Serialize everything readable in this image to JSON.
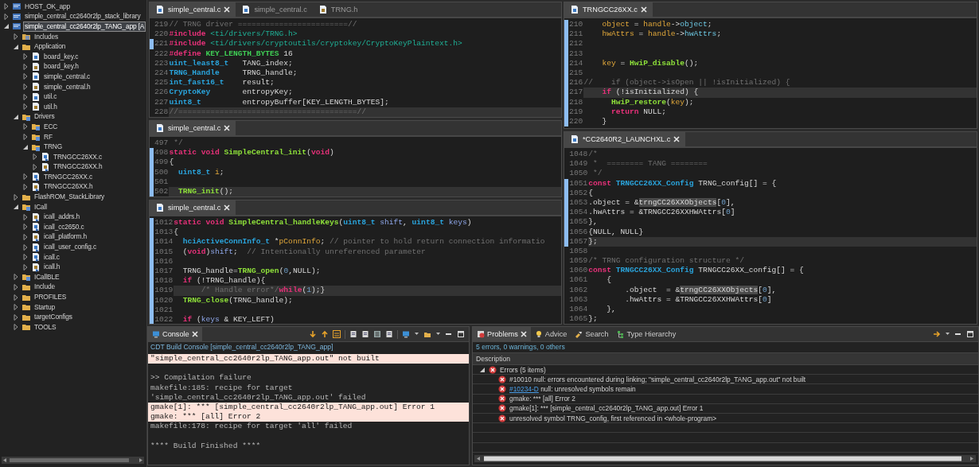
{
  "project_tree": [
    {
      "label": "HOST_OK_app",
      "kind": "project",
      "expanded": false,
      "selected": false
    },
    {
      "label": "simple_central_cc2640r2lp_stack_library",
      "kind": "project",
      "expanded": false,
      "selected": false
    },
    {
      "label": "simple_central_cc2640r2lp_TANG_app [A",
      "kind": "project",
      "expanded": true,
      "selected": true,
      "children": [
        {
          "label": "Includes",
          "kind": "includes",
          "expanded": false,
          "selected": false
        },
        {
          "label": "Application",
          "kind": "folder",
          "expanded": true,
          "selected": false,
          "children": [
            {
              "label": "board_key.c",
              "kind": "c",
              "expanded": false,
              "selected": false
            },
            {
              "label": "board_key.h",
              "kind": "h",
              "expanded": false,
              "selected": false
            },
            {
              "label": "simple_central.c",
              "kind": "c",
              "expanded": false,
              "selected": false
            },
            {
              "label": "simple_central.h",
              "kind": "h",
              "expanded": false,
              "selected": false
            },
            {
              "label": "util.c",
              "kind": "c",
              "expanded": false,
              "selected": false
            },
            {
              "label": "util.h",
              "kind": "h",
              "expanded": false,
              "selected": false
            }
          ]
        },
        {
          "label": "Drivers",
          "kind": "linked-folder",
          "expanded": true,
          "selected": false,
          "children": [
            {
              "label": "ECC",
              "kind": "linked-folder",
              "expanded": false,
              "selected": false
            },
            {
              "label": "RF",
              "kind": "linked-folder",
              "expanded": false,
              "selected": false
            },
            {
              "label": "TRNG",
              "kind": "linked-folder",
              "expanded": true,
              "selected": false,
              "children": [
                {
                  "label": "TRNGCC26XX.c",
                  "kind": "linked-c",
                  "expanded": false,
                  "selected": false
                },
                {
                  "label": "TRNGCC26XX.h",
                  "kind": "linked-h",
                  "expanded": false,
                  "selected": false
                }
              ]
            },
            {
              "label": "TRNGCC26XX.c",
              "kind": "linked-c",
              "expanded": false,
              "selected": false
            },
            {
              "label": "TRNGCC26XX.h",
              "kind": "linked-h",
              "expanded": false,
              "selected": false
            }
          ]
        },
        {
          "label": "FlashROM_StackLibrary",
          "kind": "folder",
          "expanded": false,
          "selected": false
        },
        {
          "label": "ICall",
          "kind": "linked-folder",
          "expanded": true,
          "selected": false,
          "children": [
            {
              "label": "icall_addrs.h",
              "kind": "linked-h",
              "expanded": false,
              "selected": false
            },
            {
              "label": "icall_cc2650.c",
              "kind": "linked-c",
              "expanded": false,
              "selected": false
            },
            {
              "label": "icall_platform.h",
              "kind": "linked-h",
              "expanded": false,
              "selected": false
            },
            {
              "label": "icall_user_config.c",
              "kind": "linked-c",
              "expanded": false,
              "selected": false
            },
            {
              "label": "icall.c",
              "kind": "linked-c",
              "expanded": false,
              "selected": false
            },
            {
              "label": "icall.h",
              "kind": "linked-h",
              "expanded": false,
              "selected": false
            }
          ]
        },
        {
          "label": "ICallBLE",
          "kind": "linked-folder",
          "expanded": false,
          "selected": false
        },
        {
          "label": "Include",
          "kind": "folder",
          "expanded": false,
          "selected": false
        },
        {
          "label": "PROFILES",
          "kind": "folder",
          "expanded": false,
          "selected": false
        },
        {
          "label": "Startup",
          "kind": "folder",
          "expanded": false,
          "selected": false
        },
        {
          "label": "targetConfigs",
          "kind": "folder",
          "expanded": false,
          "selected": false
        },
        {
          "label": "TOOLS",
          "kind": "folder",
          "expanded": false,
          "selected": false
        }
      ]
    }
  ],
  "editor_columns": [
    {
      "editors": [
        {
          "tabs": [
            {
              "label": "simple_central.c",
              "kind": "c",
              "selected": true
            },
            {
              "label": "simple_central.c",
              "kind": "c",
              "selected": false
            },
            {
              "label": "TRNG.h",
              "kind": "h",
              "selected": false
            }
          ],
          "lines": [
            {
              "number": "219",
              "changed": false,
              "current": false,
              "tokens": [
                {
                  "kind": "comment",
                  "text": "// TRNG driver ========================//"
                }
              ]
            },
            {
              "number": "220",
              "changed": false,
              "current": false,
              "tokens": [
                {
                  "kind": "keyword",
                  "text": "#include "
                },
                {
                  "kind": "string",
                  "text": "<ti/drivers/TRNG.h>"
                }
              ]
            },
            {
              "number": "221",
              "changed": true,
              "current": false,
              "tokens": [
                {
                  "kind": "keyword",
                  "text": "#include "
                },
                {
                  "kind": "string",
                  "text": "<ti/drivers/cryptoutils/cryptokey/CryptoKeyPlaintext.h>"
                }
              ]
            },
            {
              "number": "222",
              "changed": false,
              "current": false,
              "tokens": [
                {
                  "kind": "keyword",
                  "text": "#define "
                },
                {
                  "kind": "macro",
                  "text": "KEY_LENGTH_BYTES"
                },
                {
                  "kind": "plain",
                  "text": " 16"
                }
              ]
            },
            {
              "number": "223",
              "changed": false,
              "current": false,
              "tokens": [
                {
                  "kind": "type",
                  "text": "uint_least8_t"
                },
                {
                  "kind": "plain",
                  "text": "   TANG_index;"
                }
              ]
            },
            {
              "number": "224",
              "changed": false,
              "current": false,
              "tokens": [
                {
                  "kind": "type",
                  "text": "TRNG_Handle"
                },
                {
                  "kind": "plain",
                  "text": "     TRNG_handle;"
                }
              ]
            },
            {
              "number": "225",
              "changed": false,
              "current": false,
              "tokens": [
                {
                  "kind": "type",
                  "text": "int_fast16_t"
                },
                {
                  "kind": "plain",
                  "text": "    result;"
                }
              ]
            },
            {
              "number": "226",
              "changed": false,
              "current": false,
              "tokens": [
                {
                  "kind": "type",
                  "text": "CryptoKey"
                },
                {
                  "kind": "plain",
                  "text": "       entropyKey;"
                }
              ]
            },
            {
              "number": "227",
              "changed": false,
              "current": false,
              "tokens": [
                {
                  "kind": "type",
                  "text": "uint8_t"
                },
                {
                  "kind": "plain",
                  "text": "         entropyBuffer[KEY_LENGTH_BYTES];"
                }
              ]
            },
            {
              "number": "228",
              "changed": false,
              "current": true,
              "tokens": [
                {
                  "kind": "comment",
                  "text": "//=======================================//"
                }
              ]
            }
          ]
        },
        {
          "tabs": [
            {
              "label": "simple_central.c",
              "kind": "c",
              "selected": true
            }
          ],
          "lines": [
            {
              "number": "497",
              "changed": false,
              "current": false,
              "tokens": [
                {
                  "kind": "comment",
                  "text": " */"
                }
              ]
            },
            {
              "number": "498",
              "changed": true,
              "current": false,
              "tokens": [
                {
                  "kind": "keyword",
                  "text": "static void "
                },
                {
                  "kind": "function",
                  "text": "SimpleCentral_init"
                },
                {
                  "kind": "plain",
                  "text": "("
                },
                {
                  "kind": "keyword",
                  "text": "void"
                },
                {
                  "kind": "plain",
                  "text": ")"
                }
              ]
            },
            {
              "number": "499",
              "changed": true,
              "current": false,
              "tokens": [
                {
                  "kind": "plain",
                  "text": "{"
                }
              ]
            },
            {
              "number": "500",
              "changed": true,
              "current": false,
              "tokens": [
                {
                  "kind": "type",
                  "text": "  uint8_t "
                },
                {
                  "kind": "variable",
                  "text": "i"
                },
                {
                  "kind": "plain",
                  "text": ";"
                }
              ]
            },
            {
              "number": "501",
              "changed": true,
              "current": false
            },
            {
              "number": "502",
              "changed": true,
              "current": true,
              "tokens": [
                {
                  "kind": "function",
                  "text": "  TRNG_init"
                },
                {
                  "kind": "plain",
                  "text": "();"
                }
              ]
            }
          ]
        },
        {
          "tabs": [
            {
              "label": "simple_central.c",
              "kind": "c",
              "selected": true
            }
          ],
          "lines": [
            {
              "number": "1012",
              "changed": true,
              "current": false,
              "tokens": [
                {
                  "kind": "keyword",
                  "text": "static void "
                },
                {
                  "kind": "function",
                  "text": "SimpleCentral_handleKeys"
                },
                {
                  "kind": "plain",
                  "text": "("
                },
                {
                  "kind": "type",
                  "text": "uint8_t "
                },
                {
                  "kind": "parameter",
                  "text": "shift"
                },
                {
                  "kind": "plain",
                  "text": ", "
                },
                {
                  "kind": "type",
                  "text": "uint8_t "
                },
                {
                  "kind": "parameter",
                  "text": "keys"
                },
                {
                  "kind": "plain",
                  "text": ")"
                }
              ]
            },
            {
              "number": "1013",
              "changed": true,
              "current": false,
              "tokens": [
                {
                  "kind": "plain",
                  "text": "{"
                }
              ]
            },
            {
              "number": "1014",
              "changed": true,
              "current": false,
              "tokens": [
                {
                  "kind": "type",
                  "text": "  hciActiveConnInfo_t"
                },
                {
                  "kind": "plain",
                  "text": " *"
                },
                {
                  "kind": "variable",
                  "text": "pConnInfo"
                },
                {
                  "kind": "plain",
                  "text": "; "
                },
                {
                  "kind": "comment",
                  "text": "// pointer to hold return connection informatio"
                }
              ]
            },
            {
              "number": "1015",
              "changed": true,
              "current": false,
              "tokens": [
                {
                  "kind": "plain",
                  "text": "  ("
                },
                {
                  "kind": "keyword",
                  "text": "void"
                },
                {
                  "kind": "plain",
                  "text": ")"
                },
                {
                  "kind": "parameter",
                  "text": "shift"
                },
                {
                  "kind": "plain",
                  "text": ";  "
                },
                {
                  "kind": "comment",
                  "text": "// Intentionally unreferenced parameter"
                }
              ]
            },
            {
              "number": "1016",
              "changed": true,
              "current": false
            },
            {
              "number": "1017",
              "changed": true,
              "current": false,
              "tokens": [
                {
                  "kind": "plain",
                  "text": "  TRNG_handle="
                },
                {
                  "kind": "function",
                  "text": "TRNG_open"
                },
                {
                  "kind": "plain",
                  "text": "("
                },
                {
                  "kind": "number",
                  "text": "0"
                },
                {
                  "kind": "plain",
                  "text": ",NULL);"
                }
              ]
            },
            {
              "number": "1018",
              "changed": true,
              "current": false,
              "tokens": [
                {
                  "kind": "keyword",
                  "text": "  if"
                },
                {
                  "kind": "plain",
                  "text": " (!TRNG_handle){"
                }
              ]
            },
            {
              "number": "1019",
              "changed": true,
              "current": true,
              "tokens": [
                {
                  "kind": "comment",
                  "text": "      /* Handle error*/"
                },
                {
                  "kind": "keyword",
                  "text": "while"
                },
                {
                  "kind": "plain",
                  "text": "("
                },
                {
                  "kind": "number",
                  "text": "1"
                },
                {
                  "kind": "plain",
                  "text": ");}"
                }
              ]
            },
            {
              "number": "1020",
              "changed": true,
              "current": false,
              "tokens": [
                {
                  "kind": "function",
                  "text": "  TRNG_close"
                },
                {
                  "kind": "plain",
                  "text": "(TRNG_handle);"
                }
              ]
            },
            {
              "number": "1021",
              "changed": true,
              "current": false
            },
            {
              "number": "1022",
              "changed": true,
              "current": false,
              "tokens": [
                {
                  "kind": "keyword",
                  "text": "  if"
                },
                {
                  "kind": "plain",
                  "text": " ("
                },
                {
                  "kind": "parameter",
                  "text": "keys"
                },
                {
                  "kind": "plain",
                  "text": " & KEY_LEFT)"
                }
              ]
            }
          ]
        }
      ]
    },
    {
      "editors": [
        {
          "tabs": [
            {
              "label": "TRNGCC26XX.c",
              "kind": "c",
              "selected": true
            }
          ],
          "lines": [
            {
              "number": "210",
              "changed": true,
              "current": false,
              "tokens": [
                {
                  "kind": "variable",
                  "text": "    object"
                },
                {
                  "kind": "plain",
                  "text": " = "
                },
                {
                  "kind": "variable",
                  "text": "handle"
                },
                {
                  "kind": "plain",
                  "text": "->"
                },
                {
                  "kind": "field",
                  "text": "object"
                },
                {
                  "kind": "plain",
                  "text": ";"
                }
              ]
            },
            {
              "number": "211",
              "changed": true,
              "current": false,
              "tokens": [
                {
                  "kind": "variable",
                  "text": "    hwAttrs"
                },
                {
                  "kind": "plain",
                  "text": " = "
                },
                {
                  "kind": "variable",
                  "text": "handle"
                },
                {
                  "kind": "plain",
                  "text": "->"
                },
                {
                  "kind": "field",
                  "text": "hwAttrs"
                },
                {
                  "kind": "plain",
                  "text": ";"
                }
              ]
            },
            {
              "number": "212",
              "changed": true,
              "current": false
            },
            {
              "number": "213",
              "changed": true,
              "current": false
            },
            {
              "number": "214",
              "changed": true,
              "current": false,
              "tokens": [
                {
                  "kind": "variable",
                  "text": "    key"
                },
                {
                  "kind": "plain",
                  "text": " = "
                },
                {
                  "kind": "function",
                  "text": "HwiP_disable"
                },
                {
                  "kind": "plain",
                  "text": "();"
                }
              ]
            },
            {
              "number": "215",
              "changed": true,
              "current": false
            },
            {
              "number": "216",
              "changed": true,
              "current": false,
              "tokens": [
                {
                  "kind": "comment",
                  "text": "//    if (object->isOpen || !isInitialized) {"
                }
              ]
            },
            {
              "number": "217",
              "changed": true,
              "current": true,
              "tokens": [
                {
                  "kind": "keyword",
                  "text": "    if"
                },
                {
                  "kind": "plain",
                  "text": " (!isInitialized) {"
                }
              ]
            },
            {
              "number": "218",
              "changed": true,
              "current": false,
              "tokens": [
                {
                  "kind": "function",
                  "text": "      HwiP_restore"
                },
                {
                  "kind": "plain",
                  "text": "("
                },
                {
                  "kind": "variable",
                  "text": "key"
                },
                {
                  "kind": "plain",
                  "text": ");"
                }
              ]
            },
            {
              "number": "219",
              "changed": true,
              "current": false,
              "tokens": [
                {
                  "kind": "keyword",
                  "text": "      return"
                },
                {
                  "kind": "plain",
                  "text": " NULL;"
                }
              ]
            },
            {
              "number": "220",
              "changed": true,
              "current": false,
              "tokens": [
                {
                  "kind": "plain",
                  "text": "    }"
                }
              ]
            }
          ]
        },
        {
          "tabs": [
            {
              "label": "*CC2640R2_LAUNCHXL.c",
              "kind": "c",
              "selected": true
            }
          ],
          "lines": [
            {
              "number": "1048",
              "changed": false,
              "current": false,
              "tokens": [
                {
                  "kind": "comment",
                  "text": "/*"
                }
              ]
            },
            {
              "number": "1049",
              "changed": false,
              "current": false,
              "tokens": [
                {
                  "kind": "comment",
                  "text": " *  ======== TANG ========"
                }
              ]
            },
            {
              "number": "1050",
              "changed": false,
              "current": false,
              "tokens": [
                {
                  "kind": "comment",
                  "text": " */"
                }
              ]
            },
            {
              "number": "1051",
              "changed": true,
              "current": false,
              "tokens": [
                {
                  "kind": "keyword",
                  "text": "const "
                },
                {
                  "kind": "type",
                  "text": "TRNGCC26XX_Config"
                },
                {
                  "kind": "plain",
                  "text": " TRNG_config[] = {"
                }
              ]
            },
            {
              "number": "1052",
              "changed": true,
              "current": false,
              "tokens": [
                {
                  "kind": "plain",
                  "text": "{"
                }
              ]
            },
            {
              "number": "1053",
              "changed": true,
              "current": false,
              "tokens": [
                {
                  "kind": "plain",
                  "text": ".object = &"
                },
                {
                  "kind": "occurrence",
                  "text": "trngCC26XXObjects"
                },
                {
                  "kind": "plain",
                  "text": "["
                },
                {
                  "kind": "number",
                  "text": "0"
                },
                {
                  "kind": "plain",
                  "text": "],"
                }
              ]
            },
            {
              "number": "1054",
              "changed": true,
              "current": false,
              "tokens": [
                {
                  "kind": "plain",
                  "text": ".hwAttrs = &TRNGCC26XXHWAttrs["
                },
                {
                  "kind": "number",
                  "text": "0"
                },
                {
                  "kind": "plain",
                  "text": "]"
                }
              ]
            },
            {
              "number": "1055",
              "changed": true,
              "current": false,
              "tokens": [
                {
                  "kind": "plain",
                  "text": "},"
                }
              ]
            },
            {
              "number": "1056",
              "changed": true,
              "current": false,
              "tokens": [
                {
                  "kind": "plain",
                  "text": "{NULL, NULL}"
                }
              ]
            },
            {
              "number": "1057",
              "changed": true,
              "current": true,
              "tokens": [
                {
                  "kind": "plain",
                  "text": "};"
                }
              ]
            },
            {
              "number": "1058",
              "changed": false,
              "current": false
            },
            {
              "number": "1059",
              "changed": false,
              "current": false,
              "tokens": [
                {
                  "kind": "comment",
                  "text": "/* TRNG configuration structure */"
                }
              ]
            },
            {
              "number": "1060",
              "changed": false,
              "current": false,
              "tokens": [
                {
                  "kind": "keyword",
                  "text": "const "
                },
                {
                  "kind": "type",
                  "text": "TRNGCC26XX_Config"
                },
                {
                  "kind": "plain",
                  "text": " TRNGCC26XX_config[] = {"
                }
              ]
            },
            {
              "number": "1061",
              "changed": false,
              "current": false,
              "tokens": [
                {
                  "kind": "plain",
                  "text": "    {"
                }
              ]
            },
            {
              "number": "1062",
              "changed": false,
              "current": false,
              "tokens": [
                {
                  "kind": "plain",
                  "text": "        .object  = &"
                },
                {
                  "kind": "occurrence",
                  "text": "trngCC26XXObjects"
                },
                {
                  "kind": "plain",
                  "text": "["
                },
                {
                  "kind": "number",
                  "text": "0"
                },
                {
                  "kind": "plain",
                  "text": "],"
                }
              ]
            },
            {
              "number": "1063",
              "changed": false,
              "current": false,
              "tokens": [
                {
                  "kind": "plain",
                  "text": "        .hwAttrs = &TRNGCC26XXHWAttrs["
                },
                {
                  "kind": "number",
                  "text": "0"
                },
                {
                  "kind": "plain",
                  "text": "]"
                }
              ]
            },
            {
              "number": "1064",
              "changed": false,
              "current": false,
              "tokens": [
                {
                  "kind": "plain",
                  "text": "    },"
                }
              ]
            },
            {
              "number": "1065",
              "changed": false,
              "current": false,
              "tokens": [
                {
                  "kind": "plain",
                  "text": "};"
                }
              ]
            }
          ]
        }
      ]
    }
  ],
  "console": {
    "tab": "Console",
    "subtitle": "CDT Build Console [simple_central_cc2640r2lp_TANG_app]",
    "lines": [
      {
        "kind": "text",
        "text": "\"simple_central_cc2640r2lp_TANG_app.out\" not built",
        "error": true
      },
      {
        "kind": "blank",
        "error": false
      },
      {
        "kind": "text",
        "text": ">> Compilation failure",
        "error": false
      },
      {
        "kind": "text",
        "text": "makefile:185: recipe for target",
        "error": false
      },
      {
        "kind": "text",
        "text": "'simple_central_cc2640r2lp_TANG_app.out' failed",
        "error": false
      },
      {
        "kind": "text",
        "text": "gmake[1]: *** [simple_central_cc2640r2lp_TANG_app.out] Error 1",
        "error": true
      },
      {
        "kind": "text",
        "text": "gmake: *** [all] Error 2",
        "error": true
      },
      {
        "kind": "text",
        "text": "makefile:178: recipe for target 'all' failed",
        "error": false
      },
      {
        "kind": "blank",
        "error": false
      },
      {
        "kind": "text",
        "text": "**** Build Finished ****",
        "error": false
      }
    ]
  },
  "problems": {
    "tabs": [
      {
        "label": "Problems",
        "selected": true
      },
      {
        "label": "Advice",
        "selected": false
      },
      {
        "label": "Search",
        "selected": false
      },
      {
        "label": "Type Hierarchy",
        "selected": false
      }
    ],
    "summary": "5 errors, 0 warnings, 0 others",
    "column": "Description",
    "groups": [
      {
        "label": "Errors (5 items)",
        "expanded": true,
        "items": [
          {
            "text": "#10010 null: errors encountered during linking; \"simple_central_cc2640r2lp_TANG_app.out\" not built"
          },
          {
            "link": "#10234-D",
            "text": "null: unresolved symbols remain"
          },
          {
            "text": "gmake: *** [all] Error 2"
          },
          {
            "text": "gmake[1]: *** [simple_central_cc2640r2lp_TANG_app.out] Error 1"
          },
          {
            "text": "unresolved symbol TRNG_config, first referenced in <whole-program>"
          }
        ]
      }
    ]
  }
}
